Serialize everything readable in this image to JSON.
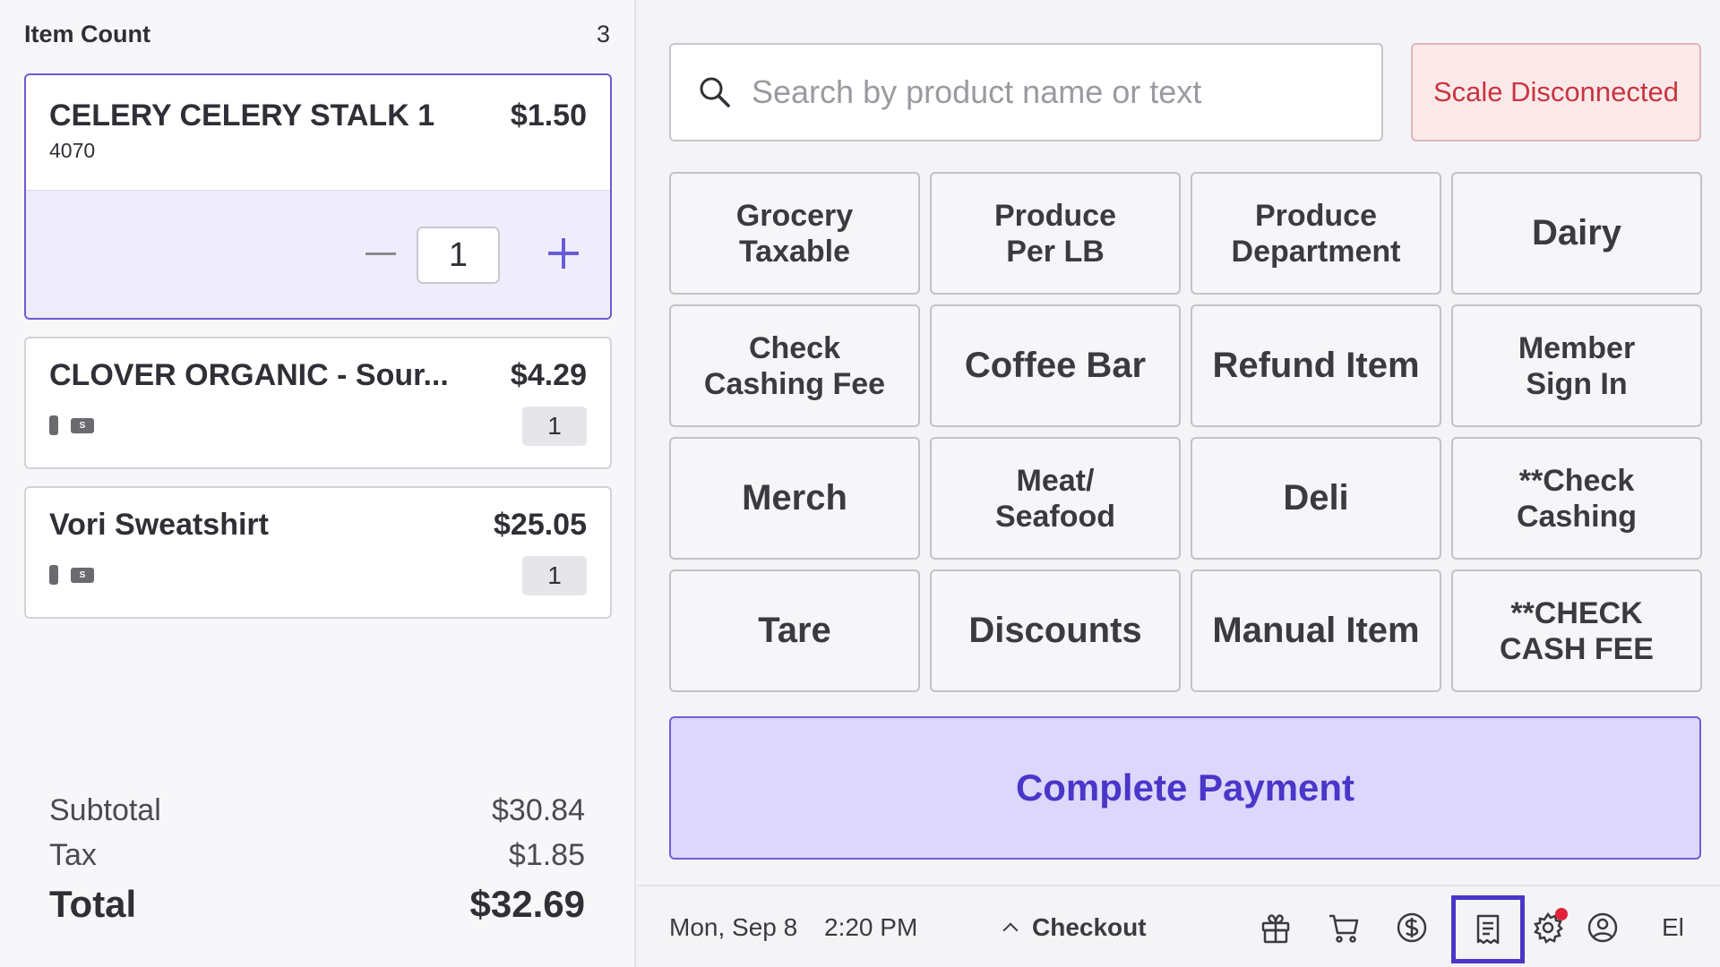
{
  "cart": {
    "item_count_label": "Item Count",
    "item_count": "3",
    "items": [
      {
        "name": "CELERY CELERY STALK 1",
        "price": "$1.50",
        "code": "4070",
        "qty": "1"
      },
      {
        "name": "CLOVER ORGANIC - Sour...",
        "price": "$4.29",
        "qty": "1",
        "tag_s": "S"
      },
      {
        "name": "Vori Sweatshirt",
        "price": "$25.05",
        "qty": "1",
        "tag_s": "S"
      }
    ],
    "subtotal_label": "Subtotal",
    "subtotal": "$30.84",
    "tax_label": "Tax",
    "tax": "$1.85",
    "total_label": "Total",
    "total": "$32.69"
  },
  "search": {
    "placeholder": "Search by product name or text",
    "icon": "search-icon"
  },
  "scale_status": "Scale Disconnected",
  "tiles": [
    "Grocery\nTaxable",
    "Produce\nPer LB",
    "Produce\nDepartment",
    "Dairy",
    "Check\nCashing Fee",
    "Coffee Bar",
    "Refund Item",
    "Member\nSign In",
    "Merch",
    "Meat/\nSeafood",
    "Deli",
    "**Check\nCashing",
    "Tare",
    "Discounts",
    "Manual Item",
    "**CHECK\nCASH FEE"
  ],
  "complete_payment": "Complete Payment",
  "bottom": {
    "date": "Mon, Sep 8",
    "time": "2:20 PM",
    "checkout": "Checkout",
    "user": "El",
    "icons": [
      "gift-icon",
      "cart-icon",
      "dollar-icon",
      "receipt-icon",
      "settings-icon",
      "user-icon"
    ]
  },
  "colors": {
    "accent": "#6b5bd6",
    "payment_bg": "#dcd7fb",
    "payment_text": "#4a36c9",
    "scale_bg": "#fbe9ea",
    "scale_text": "#c9343f",
    "notification_dot": "#e0243a"
  }
}
